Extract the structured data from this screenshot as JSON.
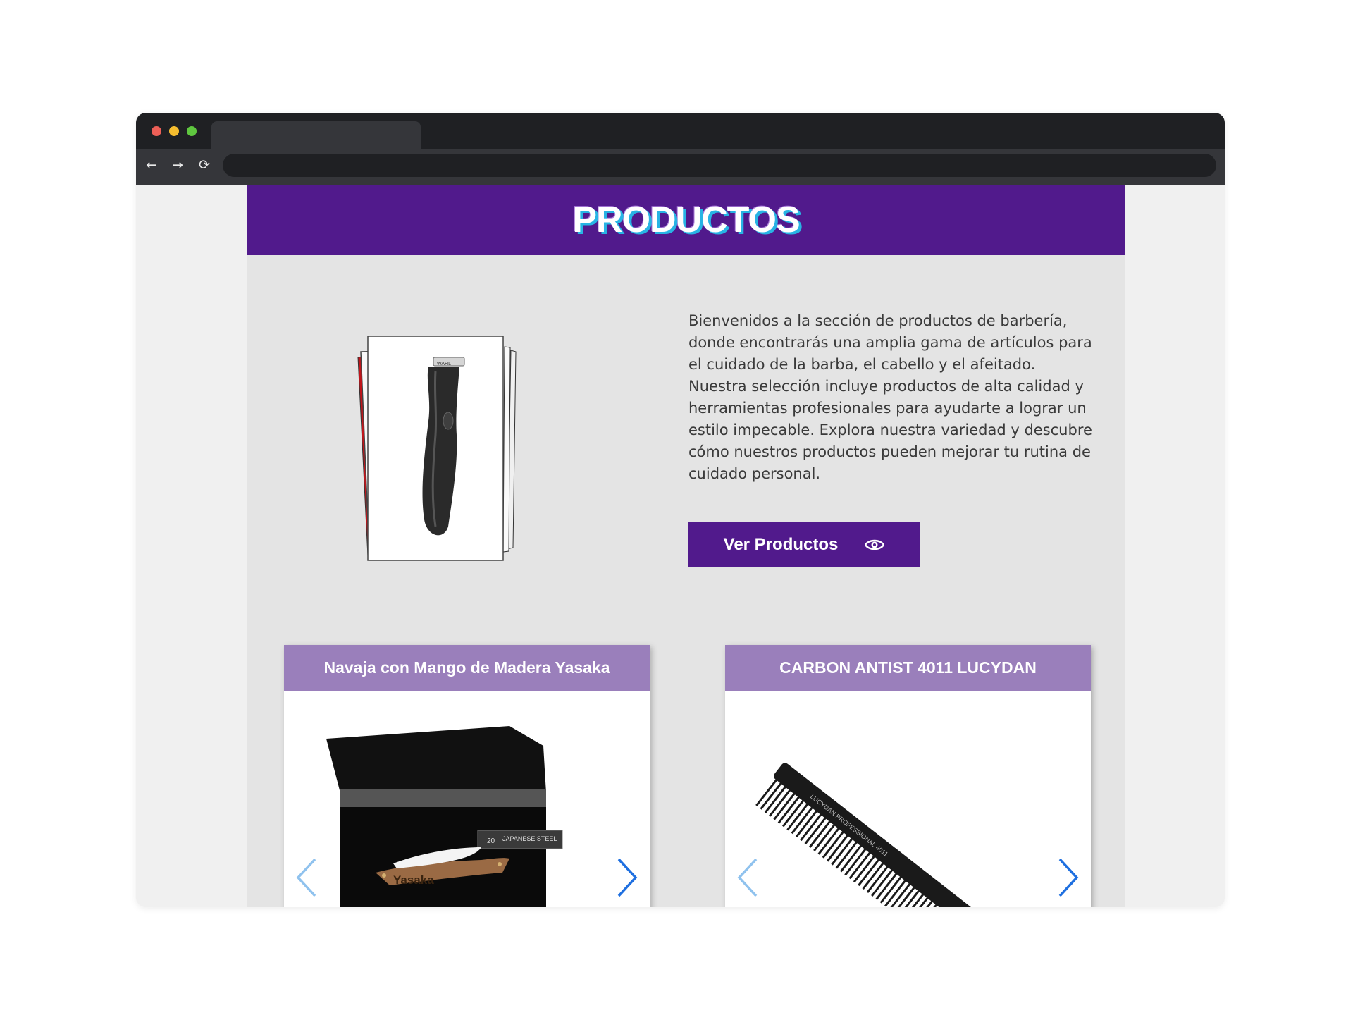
{
  "browser": {
    "url": "",
    "nav": {
      "back": "←",
      "forward": "→",
      "reload": "⟳"
    }
  },
  "header": {
    "title": "PRODUCTOS"
  },
  "hero": {
    "image_icon": "hair-clipper-photo",
    "description": "Bienvenidos a la sección de productos de barbería, donde encontrarás una amplia gama de artículos para el cuidado de la barba, el cabello y el afeitado. Nuestra selección incluye productos de alta calidad y herramientas profesionales para ayudarte a lograr un estilo impecable. Explora nuestra variedad y descubre cómo nuestros productos pueden mejorar tu rutina de cuidado personal.",
    "button_label": "Ver Productos",
    "button_icon": "eye-icon"
  },
  "products": [
    {
      "title": "Navaja con Mango de Madera Yasaka",
      "image_icon": "razor-in-case-photo",
      "brand_text": "Yasaka",
      "badge_text": "JAPANESE STEEL",
      "badge_num": "20"
    },
    {
      "title": "CARBON ANTIST 4011 LUCYDAN",
      "image_icon": "comb-photo",
      "brand_text": "LUCYDAN PROFESSIONAL 4011"
    }
  ],
  "colors": {
    "brand_purple": "#511a8c",
    "card_header": "#9a7fbb",
    "page_bg": "#e4e4e4",
    "arrow_prev": "#8fc2ee",
    "arrow_next": "#1e6fe0",
    "title_shadow": "#28b4e4"
  }
}
